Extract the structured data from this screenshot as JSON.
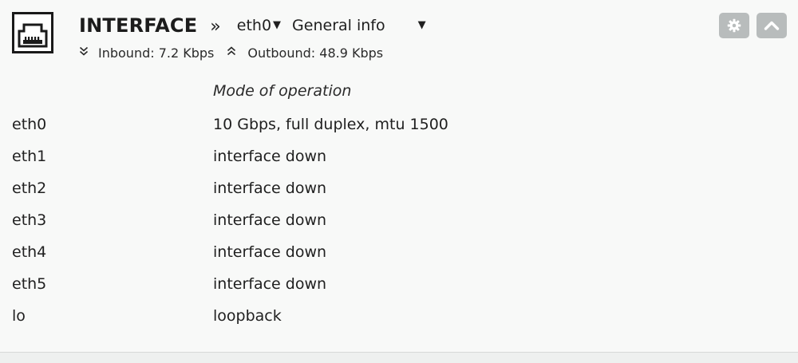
{
  "header": {
    "title": "INTERFACE",
    "separator": "»",
    "interface_select": "eth0",
    "view_select": "General info",
    "caret": "▼",
    "inbound_arrow": "≚",
    "inbound_text": "Inbound: 7.2 Kbps",
    "outbound_arrow": "≙",
    "outbound_text": "Outbound: 48.9 Kbps",
    "logo_icon": "ethernet-port-icon",
    "buttons": [
      {
        "name": "settings-button",
        "icon": "gear-icon"
      },
      {
        "name": "collapse-button",
        "icon": "chevron-up-icon"
      }
    ]
  },
  "table": {
    "columns": [
      "",
      "Mode of operation"
    ],
    "rows": [
      {
        "name": "eth0",
        "mode": "10 Gbps, full duplex, mtu 1500"
      },
      {
        "name": "eth1",
        "mode": "interface down"
      },
      {
        "name": "eth2",
        "mode": "interface down"
      },
      {
        "name": "eth3",
        "mode": "interface down"
      },
      {
        "name": "eth4",
        "mode": "interface down"
      },
      {
        "name": "eth5",
        "mode": "interface down"
      },
      {
        "name": "lo",
        "mode": "loopback"
      }
    ]
  },
  "colors": {
    "background": "#f8f9f8",
    "button": "#b8bcbc",
    "text": "#1f1f1f"
  }
}
